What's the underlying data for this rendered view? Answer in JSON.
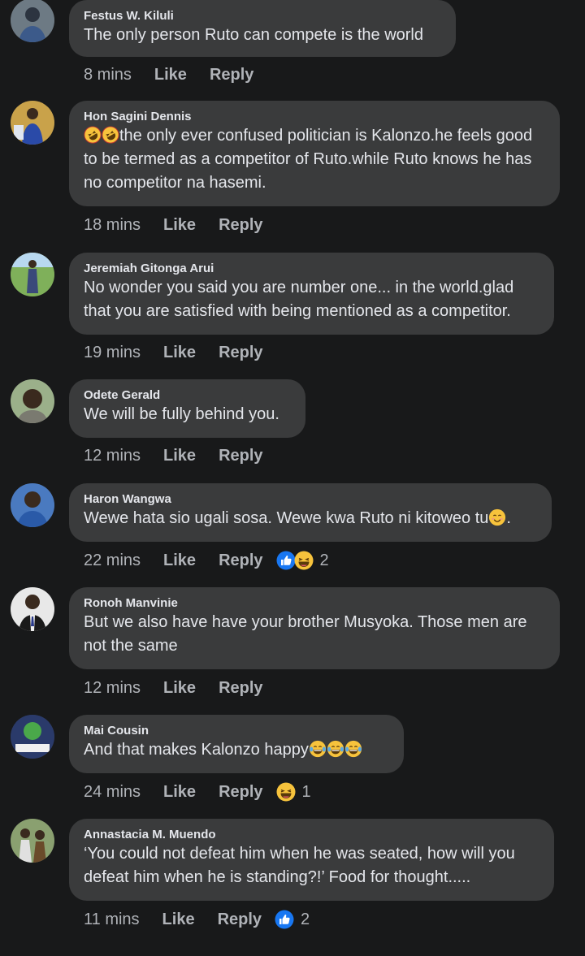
{
  "comments": [
    {
      "name": "Festus W. Kiluli",
      "text": "The only person Ruto can compete is the world",
      "time": "8 mins",
      "like": "Like",
      "reply": "Reply"
    },
    {
      "name": "Hon Sagini Dennis",
      "text": "the only ever confused politician is Kalonzo.he feels good to be termed as a competitor of Ruto.while Ruto knows he has no competitor na hasemi.",
      "time": "18 mins",
      "like": "Like",
      "reply": "Reply"
    },
    {
      "name": "Jeremiah Gitonga Arui",
      "text": "No wonder you said you are number one... in the world.glad that you are satisfied with being mentioned as a competitor.",
      "time": "19 mins",
      "like": "Like",
      "reply": "Reply"
    },
    {
      "name": "Odete Gerald",
      "text": "We will be fully behind you.",
      "time": "12 mins",
      "like": "Like",
      "reply": "Reply"
    },
    {
      "name": "Haron Wangwa",
      "text": "Wewe hata sio ugali sosa. Wewe kwa Ruto ni kitoweo tu",
      "text_end": ".",
      "time": "22 mins",
      "like": "Like",
      "reply": "Reply",
      "reaction_count": "2"
    },
    {
      "name": "Ronoh Manvinie",
      "text": "But we also have have your brother Musyoka. Those men are not the same",
      "time": "12 mins",
      "like": "Like",
      "reply": "Reply"
    },
    {
      "name": "Mai Cousin",
      "text": "And that makes Kalonzo happy",
      "time": "24 mins",
      "like": "Like",
      "reply": "Reply",
      "reaction_count": "1"
    },
    {
      "name": "Annastacia M. Muendo",
      "text": "‘You could not defeat him when he was seated, how will you defeat him when he is standing?!’ Food for thought.....",
      "time": "11 mins",
      "like": "Like",
      "reply": "Reply",
      "reaction_count": "2"
    }
  ],
  "colors": {
    "background": "#18191a",
    "bubble": "#3a3b3c",
    "text": "#e4e6eb",
    "muted": "#b0b3b8",
    "like_blue": "#1877f2",
    "emoji_yellow": "#f7c33c"
  },
  "icons": {
    "like_reaction": "thumbs-up-icon",
    "haha_reaction": "laughing-face-icon",
    "rofl": "rolling-on-floor-laughing-emoji",
    "smile": "smiling-face-emoji",
    "tears_of_joy": "tears-of-joy-emoji"
  }
}
